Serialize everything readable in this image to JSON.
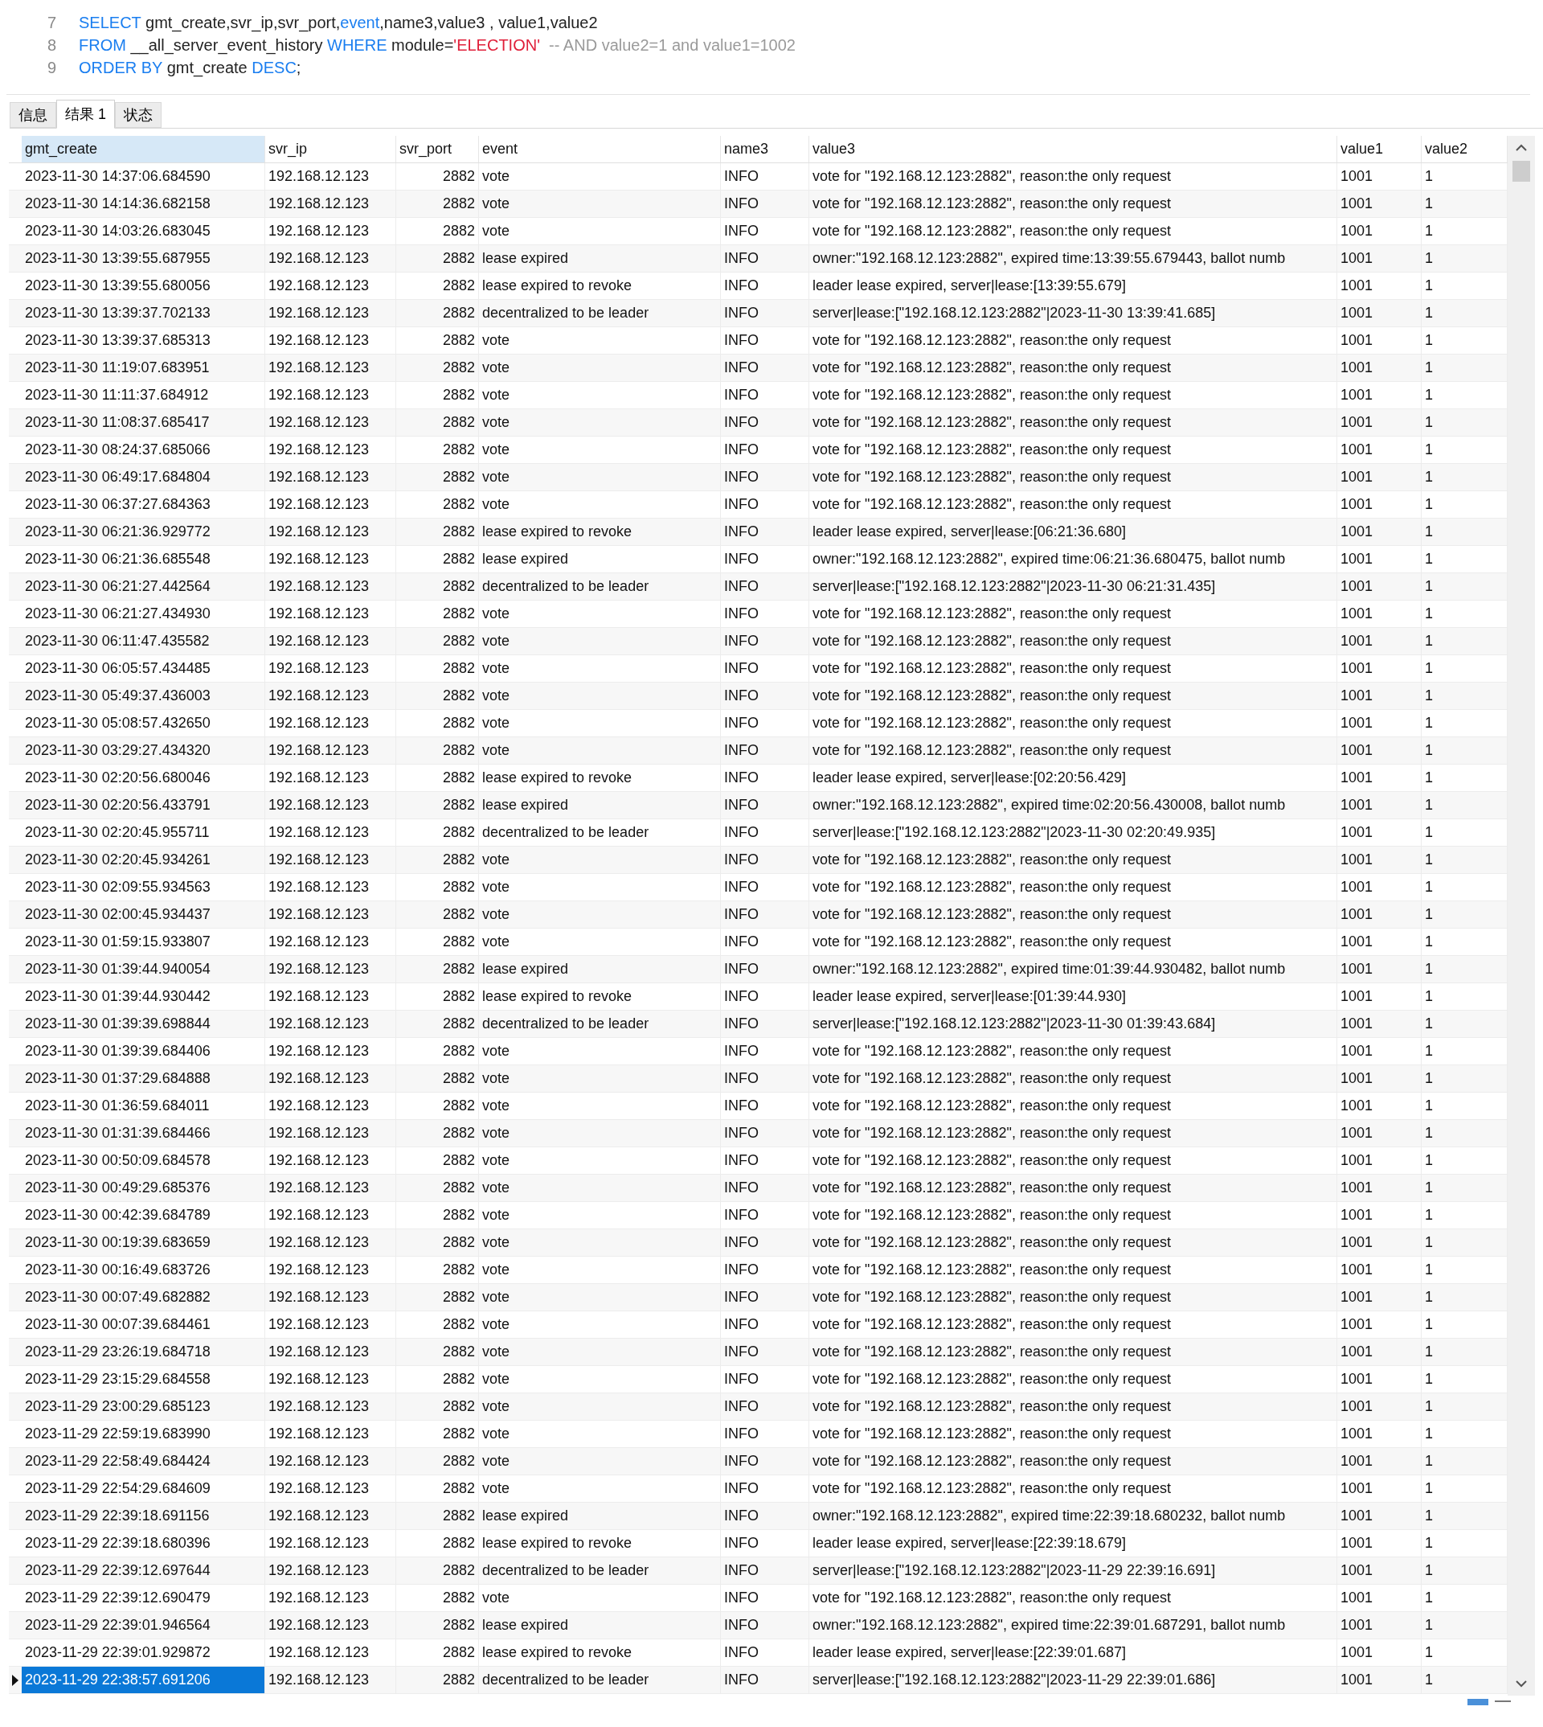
{
  "editor": {
    "lines": [
      {
        "number": "7",
        "tokens": [
          {
            "kind": "keyword",
            "text": "SELECT"
          },
          {
            "kind": "text",
            "text": " gmt_create,svr_ip,svr_port,"
          },
          {
            "kind": "keyword",
            "text": "event"
          },
          {
            "kind": "text",
            "text": ",name3,value3 , value1,value2"
          }
        ]
      },
      {
        "number": "8",
        "tokens": [
          {
            "kind": "keyword",
            "text": "FROM"
          },
          {
            "kind": "text",
            "text": " __all_server_event_history "
          },
          {
            "kind": "keyword",
            "text": "WHERE"
          },
          {
            "kind": "text",
            "text": " module="
          },
          {
            "kind": "string",
            "text": "'ELECTION'"
          },
          {
            "kind": "comment",
            "text": "  -- AND value2=1 and value1=1002"
          }
        ]
      },
      {
        "number": "9",
        "tokens": [
          {
            "kind": "keyword",
            "text": "ORDER BY"
          },
          {
            "kind": "text",
            "text": " gmt_create "
          },
          {
            "kind": "keyword",
            "text": "DESC"
          },
          {
            "kind": "text",
            "text": ";"
          }
        ]
      }
    ]
  },
  "tabs": [
    {
      "label": "信息",
      "selected": false
    },
    {
      "label": "结果 1",
      "selected": true
    },
    {
      "label": "状态",
      "selected": false
    }
  ],
  "table": {
    "columns": [
      {
        "label": "gmt_create",
        "selected": true
      },
      {
        "label": "svr_ip",
        "selected": false
      },
      {
        "label": "svr_port",
        "selected": false
      },
      {
        "label": "event",
        "selected": false
      },
      {
        "label": "name3",
        "selected": false
      },
      {
        "label": "value3",
        "selected": false
      },
      {
        "label": "value1",
        "selected": false
      },
      {
        "label": "value2",
        "selected": false
      }
    ],
    "rows": [
      {
        "cells": [
          "2023-11-30 14:37:06.684590",
          "192.168.12.123",
          "2882",
          "vote",
          "INFO",
          "vote for \"192.168.12.123:2882\", reason:the only request",
          "1001",
          "1"
        ],
        "selected": false
      },
      {
        "cells": [
          "2023-11-30 14:14:36.682158",
          "192.168.12.123",
          "2882",
          "vote",
          "INFO",
          "vote for \"192.168.12.123:2882\", reason:the only request",
          "1001",
          "1"
        ],
        "selected": false
      },
      {
        "cells": [
          "2023-11-30 14:03:26.683045",
          "192.168.12.123",
          "2882",
          "vote",
          "INFO",
          "vote for \"192.168.12.123:2882\", reason:the only request",
          "1001",
          "1"
        ],
        "selected": false
      },
      {
        "cells": [
          "2023-11-30 13:39:55.687955",
          "192.168.12.123",
          "2882",
          "lease expired",
          "INFO",
          "owner:\"192.168.12.123:2882\", expired time:13:39:55.679443, ballot numb",
          "1001",
          "1"
        ],
        "selected": false
      },
      {
        "cells": [
          "2023-11-30 13:39:55.680056",
          "192.168.12.123",
          "2882",
          "lease expired to revoke",
          "INFO",
          "leader lease expired, server|lease:[13:39:55.679]",
          "1001",
          "1"
        ],
        "selected": false
      },
      {
        "cells": [
          "2023-11-30 13:39:37.702133",
          "192.168.12.123",
          "2882",
          "decentralized to be leader",
          "INFO",
          "server|lease:[\"192.168.12.123:2882\"|2023-11-30 13:39:41.685]",
          "1001",
          "1"
        ],
        "selected": false
      },
      {
        "cells": [
          "2023-11-30 13:39:37.685313",
          "192.168.12.123",
          "2882",
          "vote",
          "INFO",
          "vote for \"192.168.12.123:2882\", reason:the only request",
          "1001",
          "1"
        ],
        "selected": false
      },
      {
        "cells": [
          "2023-11-30 11:19:07.683951",
          "192.168.12.123",
          "2882",
          "vote",
          "INFO",
          "vote for \"192.168.12.123:2882\", reason:the only request",
          "1001",
          "1"
        ],
        "selected": false
      },
      {
        "cells": [
          "2023-11-30 11:11:37.684912",
          "192.168.12.123",
          "2882",
          "vote",
          "INFO",
          "vote for \"192.168.12.123:2882\", reason:the only request",
          "1001",
          "1"
        ],
        "selected": false
      },
      {
        "cells": [
          "2023-11-30 11:08:37.685417",
          "192.168.12.123",
          "2882",
          "vote",
          "INFO",
          "vote for \"192.168.12.123:2882\", reason:the only request",
          "1001",
          "1"
        ],
        "selected": false
      },
      {
        "cells": [
          "2023-11-30 08:24:37.685066",
          "192.168.12.123",
          "2882",
          "vote",
          "INFO",
          "vote for \"192.168.12.123:2882\", reason:the only request",
          "1001",
          "1"
        ],
        "selected": false
      },
      {
        "cells": [
          "2023-11-30 06:49:17.684804",
          "192.168.12.123",
          "2882",
          "vote",
          "INFO",
          "vote for \"192.168.12.123:2882\", reason:the only request",
          "1001",
          "1"
        ],
        "selected": false
      },
      {
        "cells": [
          "2023-11-30 06:37:27.684363",
          "192.168.12.123",
          "2882",
          "vote",
          "INFO",
          "vote for \"192.168.12.123:2882\", reason:the only request",
          "1001",
          "1"
        ],
        "selected": false
      },
      {
        "cells": [
          "2023-11-30 06:21:36.929772",
          "192.168.12.123",
          "2882",
          "lease expired to revoke",
          "INFO",
          "leader lease expired, server|lease:[06:21:36.680]",
          "1001",
          "1"
        ],
        "selected": false
      },
      {
        "cells": [
          "2023-11-30 06:21:36.685548",
          "192.168.12.123",
          "2882",
          "lease expired",
          "INFO",
          "owner:\"192.168.12.123:2882\", expired time:06:21:36.680475, ballot numb",
          "1001",
          "1"
        ],
        "selected": false
      },
      {
        "cells": [
          "2023-11-30 06:21:27.442564",
          "192.168.12.123",
          "2882",
          "decentralized to be leader",
          "INFO",
          "server|lease:[\"192.168.12.123:2882\"|2023-11-30 06:21:31.435]",
          "1001",
          "1"
        ],
        "selected": false
      },
      {
        "cells": [
          "2023-11-30 06:21:27.434930",
          "192.168.12.123",
          "2882",
          "vote",
          "INFO",
          "vote for \"192.168.12.123:2882\", reason:the only request",
          "1001",
          "1"
        ],
        "selected": false
      },
      {
        "cells": [
          "2023-11-30 06:11:47.435582",
          "192.168.12.123",
          "2882",
          "vote",
          "INFO",
          "vote for \"192.168.12.123:2882\", reason:the only request",
          "1001",
          "1"
        ],
        "selected": false
      },
      {
        "cells": [
          "2023-11-30 06:05:57.434485",
          "192.168.12.123",
          "2882",
          "vote",
          "INFO",
          "vote for \"192.168.12.123:2882\", reason:the only request",
          "1001",
          "1"
        ],
        "selected": false
      },
      {
        "cells": [
          "2023-11-30 05:49:37.436003",
          "192.168.12.123",
          "2882",
          "vote",
          "INFO",
          "vote for \"192.168.12.123:2882\", reason:the only request",
          "1001",
          "1"
        ],
        "selected": false
      },
      {
        "cells": [
          "2023-11-30 05:08:57.432650",
          "192.168.12.123",
          "2882",
          "vote",
          "INFO",
          "vote for \"192.168.12.123:2882\", reason:the only request",
          "1001",
          "1"
        ],
        "selected": false
      },
      {
        "cells": [
          "2023-11-30 03:29:27.434320",
          "192.168.12.123",
          "2882",
          "vote",
          "INFO",
          "vote for \"192.168.12.123:2882\", reason:the only request",
          "1001",
          "1"
        ],
        "selected": false
      },
      {
        "cells": [
          "2023-11-30 02:20:56.680046",
          "192.168.12.123",
          "2882",
          "lease expired to revoke",
          "INFO",
          "leader lease expired, server|lease:[02:20:56.429]",
          "1001",
          "1"
        ],
        "selected": false
      },
      {
        "cells": [
          "2023-11-30 02:20:56.433791",
          "192.168.12.123",
          "2882",
          "lease expired",
          "INFO",
          "owner:\"192.168.12.123:2882\", expired time:02:20:56.430008, ballot numb",
          "1001",
          "1"
        ],
        "selected": false
      },
      {
        "cells": [
          "2023-11-30 02:20:45.955711",
          "192.168.12.123",
          "2882",
          "decentralized to be leader",
          "INFO",
          "server|lease:[\"192.168.12.123:2882\"|2023-11-30 02:20:49.935]",
          "1001",
          "1"
        ],
        "selected": false
      },
      {
        "cells": [
          "2023-11-30 02:20:45.934261",
          "192.168.12.123",
          "2882",
          "vote",
          "INFO",
          "vote for \"192.168.12.123:2882\", reason:the only request",
          "1001",
          "1"
        ],
        "selected": false
      },
      {
        "cells": [
          "2023-11-30 02:09:55.934563",
          "192.168.12.123",
          "2882",
          "vote",
          "INFO",
          "vote for \"192.168.12.123:2882\", reason:the only request",
          "1001",
          "1"
        ],
        "selected": false
      },
      {
        "cells": [
          "2023-11-30 02:00:45.934437",
          "192.168.12.123",
          "2882",
          "vote",
          "INFO",
          "vote for \"192.168.12.123:2882\", reason:the only request",
          "1001",
          "1"
        ],
        "selected": false
      },
      {
        "cells": [
          "2023-11-30 01:59:15.933807",
          "192.168.12.123",
          "2882",
          "vote",
          "INFO",
          "vote for \"192.168.12.123:2882\", reason:the only request",
          "1001",
          "1"
        ],
        "selected": false
      },
      {
        "cells": [
          "2023-11-30 01:39:44.940054",
          "192.168.12.123",
          "2882",
          "lease expired",
          "INFO",
          "owner:\"192.168.12.123:2882\", expired time:01:39:44.930482, ballot numb",
          "1001",
          "1"
        ],
        "selected": false
      },
      {
        "cells": [
          "2023-11-30 01:39:44.930442",
          "192.168.12.123",
          "2882",
          "lease expired to revoke",
          "INFO",
          "leader lease expired, server|lease:[01:39:44.930]",
          "1001",
          "1"
        ],
        "selected": false
      },
      {
        "cells": [
          "2023-11-30 01:39:39.698844",
          "192.168.12.123",
          "2882",
          "decentralized to be leader",
          "INFO",
          "server|lease:[\"192.168.12.123:2882\"|2023-11-30 01:39:43.684]",
          "1001",
          "1"
        ],
        "selected": false
      },
      {
        "cells": [
          "2023-11-30 01:39:39.684406",
          "192.168.12.123",
          "2882",
          "vote",
          "INFO",
          "vote for \"192.168.12.123:2882\", reason:the only request",
          "1001",
          "1"
        ],
        "selected": false
      },
      {
        "cells": [
          "2023-11-30 01:37:29.684888",
          "192.168.12.123",
          "2882",
          "vote",
          "INFO",
          "vote for \"192.168.12.123:2882\", reason:the only request",
          "1001",
          "1"
        ],
        "selected": false
      },
      {
        "cells": [
          "2023-11-30 01:36:59.684011",
          "192.168.12.123",
          "2882",
          "vote",
          "INFO",
          "vote for \"192.168.12.123:2882\", reason:the only request",
          "1001",
          "1"
        ],
        "selected": false
      },
      {
        "cells": [
          "2023-11-30 01:31:39.684466",
          "192.168.12.123",
          "2882",
          "vote",
          "INFO",
          "vote for \"192.168.12.123:2882\", reason:the only request",
          "1001",
          "1"
        ],
        "selected": false
      },
      {
        "cells": [
          "2023-11-30 00:50:09.684578",
          "192.168.12.123",
          "2882",
          "vote",
          "INFO",
          "vote for \"192.168.12.123:2882\", reason:the only request",
          "1001",
          "1"
        ],
        "selected": false
      },
      {
        "cells": [
          "2023-11-30 00:49:29.685376",
          "192.168.12.123",
          "2882",
          "vote",
          "INFO",
          "vote for \"192.168.12.123:2882\", reason:the only request",
          "1001",
          "1"
        ],
        "selected": false
      },
      {
        "cells": [
          "2023-11-30 00:42:39.684789",
          "192.168.12.123",
          "2882",
          "vote",
          "INFO",
          "vote for \"192.168.12.123:2882\", reason:the only request",
          "1001",
          "1"
        ],
        "selected": false
      },
      {
        "cells": [
          "2023-11-30 00:19:39.683659",
          "192.168.12.123",
          "2882",
          "vote",
          "INFO",
          "vote for \"192.168.12.123:2882\", reason:the only request",
          "1001",
          "1"
        ],
        "selected": false
      },
      {
        "cells": [
          "2023-11-30 00:16:49.683726",
          "192.168.12.123",
          "2882",
          "vote",
          "INFO",
          "vote for \"192.168.12.123:2882\", reason:the only request",
          "1001",
          "1"
        ],
        "selected": false
      },
      {
        "cells": [
          "2023-11-30 00:07:49.682882",
          "192.168.12.123",
          "2882",
          "vote",
          "INFO",
          "vote for \"192.168.12.123:2882\", reason:the only request",
          "1001",
          "1"
        ],
        "selected": false
      },
      {
        "cells": [
          "2023-11-30 00:07:39.684461",
          "192.168.12.123",
          "2882",
          "vote",
          "INFO",
          "vote for \"192.168.12.123:2882\", reason:the only request",
          "1001",
          "1"
        ],
        "selected": false
      },
      {
        "cells": [
          "2023-11-29 23:26:19.684718",
          "192.168.12.123",
          "2882",
          "vote",
          "INFO",
          "vote for \"192.168.12.123:2882\", reason:the only request",
          "1001",
          "1"
        ],
        "selected": false
      },
      {
        "cells": [
          "2023-11-29 23:15:29.684558",
          "192.168.12.123",
          "2882",
          "vote",
          "INFO",
          "vote for \"192.168.12.123:2882\", reason:the only request",
          "1001",
          "1"
        ],
        "selected": false
      },
      {
        "cells": [
          "2023-11-29 23:00:29.685123",
          "192.168.12.123",
          "2882",
          "vote",
          "INFO",
          "vote for \"192.168.12.123:2882\", reason:the only request",
          "1001",
          "1"
        ],
        "selected": false
      },
      {
        "cells": [
          "2023-11-29 22:59:19.683990",
          "192.168.12.123",
          "2882",
          "vote",
          "INFO",
          "vote for \"192.168.12.123:2882\", reason:the only request",
          "1001",
          "1"
        ],
        "selected": false
      },
      {
        "cells": [
          "2023-11-29 22:58:49.684424",
          "192.168.12.123",
          "2882",
          "vote",
          "INFO",
          "vote for \"192.168.12.123:2882\", reason:the only request",
          "1001",
          "1"
        ],
        "selected": false
      },
      {
        "cells": [
          "2023-11-29 22:54:29.684609",
          "192.168.12.123",
          "2882",
          "vote",
          "INFO",
          "vote for \"192.168.12.123:2882\", reason:the only request",
          "1001",
          "1"
        ],
        "selected": false
      },
      {
        "cells": [
          "2023-11-29 22:39:18.691156",
          "192.168.12.123",
          "2882",
          "lease expired",
          "INFO",
          "owner:\"192.168.12.123:2882\", expired time:22:39:18.680232, ballot numb",
          "1001",
          "1"
        ],
        "selected": false
      },
      {
        "cells": [
          "2023-11-29 22:39:18.680396",
          "192.168.12.123",
          "2882",
          "lease expired to revoke",
          "INFO",
          "leader lease expired, server|lease:[22:39:18.679]",
          "1001",
          "1"
        ],
        "selected": false
      },
      {
        "cells": [
          "2023-11-29 22:39:12.697644",
          "192.168.12.123",
          "2882",
          "decentralized to be leader",
          "INFO",
          "server|lease:[\"192.168.12.123:2882\"|2023-11-29 22:39:16.691]",
          "1001",
          "1"
        ],
        "selected": false
      },
      {
        "cells": [
          "2023-11-29 22:39:12.690479",
          "192.168.12.123",
          "2882",
          "vote",
          "INFO",
          "vote for \"192.168.12.123:2882\", reason:the only request",
          "1001",
          "1"
        ],
        "selected": false
      },
      {
        "cells": [
          "2023-11-29 22:39:01.946564",
          "192.168.12.123",
          "2882",
          "lease expired",
          "INFO",
          "owner:\"192.168.12.123:2882\", expired time:22:39:01.687291, ballot numb",
          "1001",
          "1"
        ],
        "selected": false
      },
      {
        "cells": [
          "2023-11-29 22:39:01.929872",
          "192.168.12.123",
          "2882",
          "lease expired to revoke",
          "INFO",
          "leader lease expired, server|lease:[22:39:01.687]",
          "1001",
          "1"
        ],
        "selected": false
      },
      {
        "cells": [
          "2023-11-29 22:38:57.691206",
          "192.168.12.123",
          "2882",
          "decentralized to be leader",
          "INFO",
          "server|lease:[\"192.168.12.123:2882\"|2023-11-29 22:39:01.686]",
          "1001",
          "1"
        ],
        "selected": true
      }
    ]
  }
}
